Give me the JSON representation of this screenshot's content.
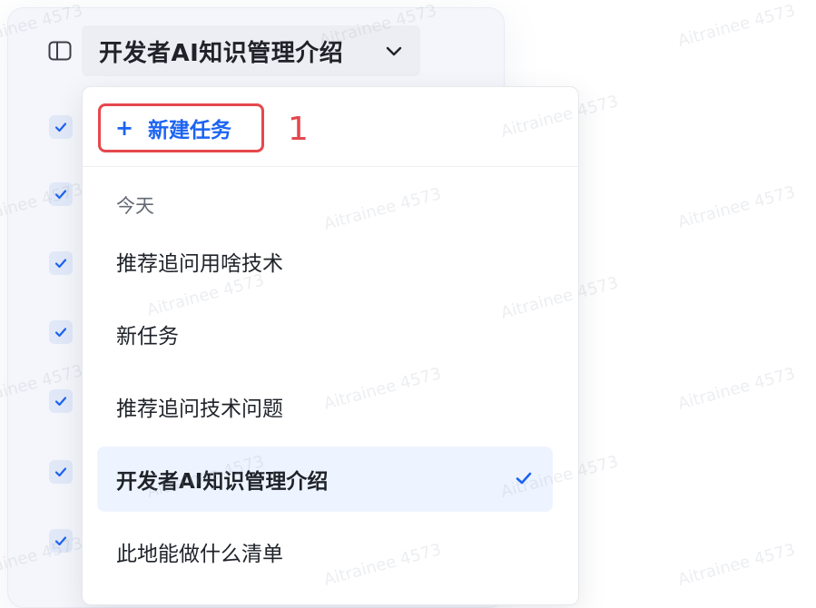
{
  "header": {
    "title": "开发者AI知识管理介绍",
    "sidebar_toggle_icon": "sidebar-panel-icon",
    "chevron_icon": "chevron-down-icon"
  },
  "dropdown": {
    "new_task": {
      "plus": "+",
      "label": "新建任务"
    },
    "annotation_number": "1",
    "section_today": "今天",
    "items": [
      {
        "label": "推荐追问用啥技术"
      },
      {
        "label": "新任务"
      },
      {
        "label": "推荐追问技术问题"
      },
      {
        "label": "开发者AI知识管理介绍",
        "selected": true
      },
      {
        "label": "此地能做什么清单"
      }
    ]
  },
  "watermark": "Aitrainee 4573",
  "colors": {
    "accent": "#1c64f2",
    "annotation": "#e5484d"
  }
}
